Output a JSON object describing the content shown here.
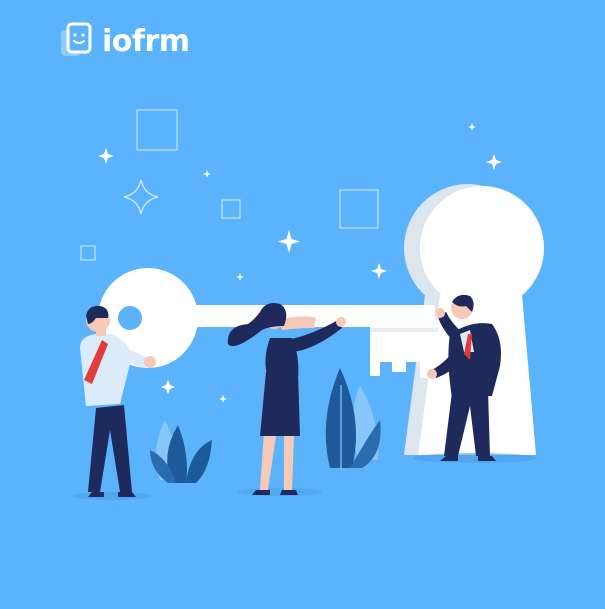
{
  "brand": {
    "name": "iofrm",
    "icon": "id-card-face-icon"
  },
  "colors": {
    "background": "#5BB4FB",
    "key": "#FFFFFF",
    "keyhole_shadow": "#DDE6EE",
    "suit": "#1F2A5C",
    "tie": "#E23B3B",
    "shirt": "#DCEBFA",
    "skin": "#F5C9B5",
    "plant_dark": "#1E5A9A",
    "plant_light": "#8EC9F7"
  },
  "illustration": {
    "subject": "team-unlocking-keyhole",
    "icons": [
      "key-icon",
      "keyhole-icon",
      "sparkle-icon",
      "plant-icon"
    ]
  }
}
